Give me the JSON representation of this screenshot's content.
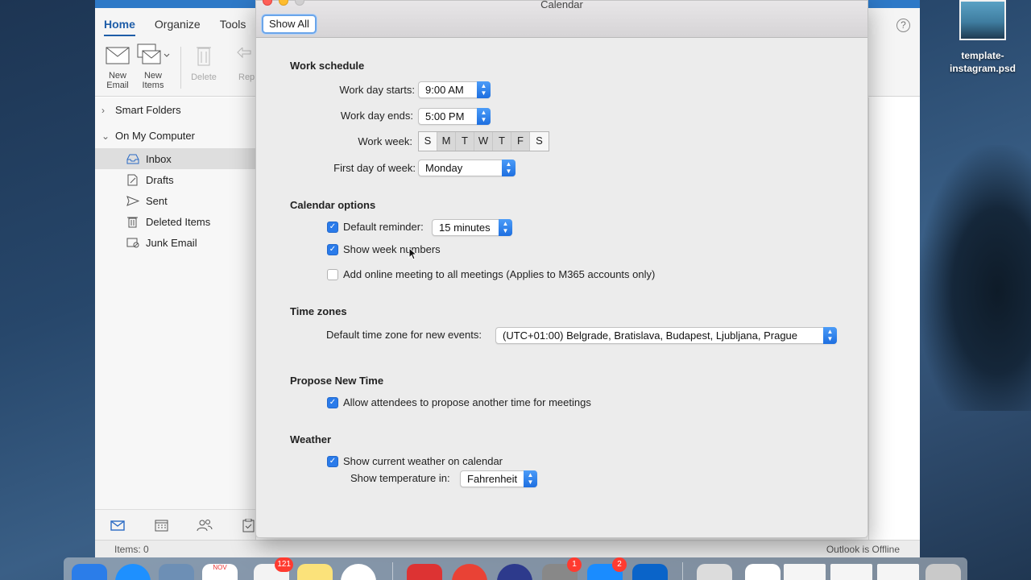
{
  "desktop": {
    "file_label": "template-\ninstagram.psd",
    "file_label_line1": "template-",
    "file_label_line2": "instagram.psd"
  },
  "outlook": {
    "tabs": [
      {
        "label": "Home",
        "active": true
      },
      {
        "label": "Organize",
        "active": false
      },
      {
        "label": "Tools",
        "active": false
      }
    ],
    "ribbon": {
      "new_email": [
        "New",
        "Email"
      ],
      "new_items": [
        "New",
        "Items"
      ],
      "delete": "Delete",
      "reply_partial": "Rep"
    },
    "sidebar": {
      "groups": [
        {
          "label": "Smart Folders",
          "expanded": false
        },
        {
          "label": "On My Computer",
          "expanded": true
        }
      ],
      "folders": [
        {
          "label": "Inbox",
          "icon": "inbox-icon",
          "selected": true
        },
        {
          "label": "Drafts",
          "icon": "drafts-icon",
          "selected": false
        },
        {
          "label": "Sent",
          "icon": "sent-icon",
          "selected": false
        },
        {
          "label": "Deleted Items",
          "icon": "trash-icon",
          "selected": false
        },
        {
          "label": "Junk Email",
          "icon": "junk-icon",
          "selected": false
        }
      ]
    },
    "nav": [
      "mail-icon",
      "calendar-icon",
      "people-icon",
      "tasks-icon"
    ],
    "status": {
      "items": "Items: 0",
      "connection": "Outlook is Offline"
    }
  },
  "prefs": {
    "title": "Calendar",
    "show_all": "Show All",
    "work_schedule": {
      "title": "Work schedule",
      "day_starts_label": "Work day starts:",
      "day_starts_value": "9:00 AM",
      "day_ends_label": "Work day ends:",
      "day_ends_value": "5:00 PM",
      "week_label": "Work week:",
      "days": [
        {
          "label": "S",
          "on": false
        },
        {
          "label": "M",
          "on": true
        },
        {
          "label": "T",
          "on": true
        },
        {
          "label": "W",
          "on": true
        },
        {
          "label": "T",
          "on": true
        },
        {
          "label": "F",
          "on": true
        },
        {
          "label": "S",
          "on": false
        }
      ],
      "first_day_label": "First day of week:",
      "first_day_value": "Monday"
    },
    "calendar_options": {
      "title": "Calendar options",
      "default_reminder_label": "Default reminder:",
      "default_reminder_checked": true,
      "default_reminder_value": "15 minutes",
      "week_numbers_label": "Show week numbers",
      "week_numbers_checked": true,
      "online_meeting_label": "Add online meeting to all meetings (Applies to M365 accounts only)",
      "online_meeting_checked": false
    },
    "time_zones": {
      "title": "Time zones",
      "label": "Default time zone for new events:",
      "value": "(UTC+01:00) Belgrade, Bratislava, Budapest, Ljubljana, Prague"
    },
    "propose_new_time": {
      "title": "Propose New Time",
      "label": "Allow attendees to propose another time for meetings",
      "checked": true
    },
    "weather": {
      "title": "Weather",
      "show_label": "Show current weather on calendar",
      "show_checked": true,
      "temp_label": "Show temperature in:",
      "temp_value": "Fahrenheit"
    }
  },
  "dock": {
    "badges": {
      "mail": "121",
      "system_prefs": "1",
      "app_store": "2"
    },
    "calendar_month": "NOV"
  },
  "colors": {
    "accent": "#2a7bea",
    "outlook_blue": "#1e5da8"
  }
}
